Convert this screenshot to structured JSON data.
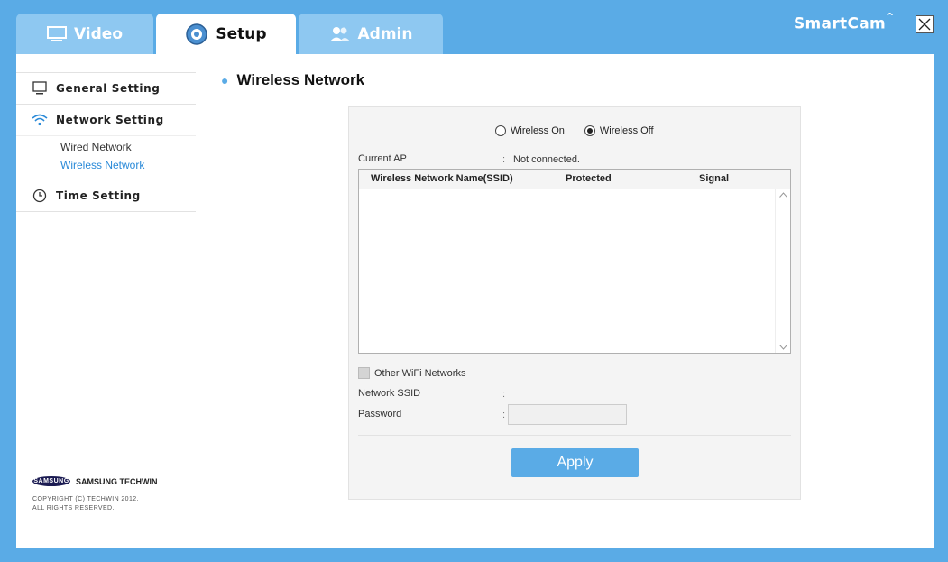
{
  "tabs": {
    "video": "Video",
    "setup": "Setup",
    "admin": "Admin"
  },
  "brand": {
    "name": "SmartCam"
  },
  "sidebar": {
    "general": "General Setting",
    "network": "Network Setting",
    "network_sub": [
      "Wired Network",
      "Wireless Network"
    ],
    "time": "Time Setting"
  },
  "footer": {
    "samsung_logo": "SAMSUNG",
    "company": "SAMSUNG TECHWIN",
    "copyright_1": "COPYRIGHT (C) TECHWIN 2012.",
    "copyright_2": "ALL RIGHTS RESERVED."
  },
  "page": {
    "title": "Wireless Network"
  },
  "form": {
    "radio_on": "Wireless On",
    "radio_off": "Wireless Off",
    "selected_radio": "off",
    "current_ap_label": "Current AP",
    "current_ap_colon": ":",
    "current_ap_value": "Not connected.",
    "table_headers": [
      "Wireless Network Name(SSID)",
      "Protected",
      "Signal"
    ],
    "other_wifi": "Other WiFi Networks",
    "ssid_label": "Network SSID",
    "ssid_colon": ":",
    "password_label": "Password",
    "password_colon": ":",
    "password_value": "",
    "apply": "Apply"
  },
  "colors": {
    "accent": "#5aabe6",
    "selected_link": "#2a8ad8"
  }
}
